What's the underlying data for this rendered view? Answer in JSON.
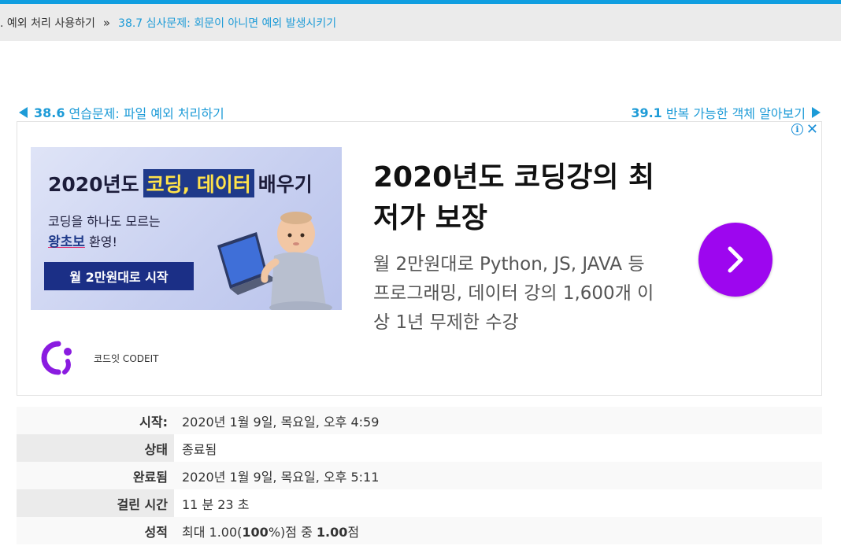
{
  "breadcrumb": {
    "previous": ". 예외 처리 사용하기",
    "separator": "»",
    "current": "38.7 심사문제: 회문이 아니면 예외 발생시키기"
  },
  "navigation": {
    "prev_number": "38.6",
    "prev_label": "연습문제: 파일 예외 처리하기",
    "next_number": "39.1",
    "next_label": "반복 가능한 객체 알아보기"
  },
  "ad": {
    "banner_title_pre": "2020년도",
    "banner_title_highlight": "코딩, 데이터",
    "banner_title_post": "배우기",
    "banner_sub_line1": "코딩을 하나도 모르는",
    "banner_sub_line2_strong": "왕초보",
    "banner_sub_line2_rest": " 환영!",
    "banner_button": "월 2만원대로 시작",
    "advertiser": "코드잇 CODEIT",
    "headline": "2020년도 코딩강의 최저가 보장",
    "description": "월 2만원대로 Python, JS, JAVA 등 프로그래밍, 데이터 강의 1,600개 이상 1년 무제한 수강",
    "info_icon": "info-icon",
    "close_icon": "close-icon",
    "cta_icon": "chevron-right-icon",
    "cta_color": "#9d06ef"
  },
  "summary": [
    {
      "label": "시작:",
      "value": "2020년 1월 9일, 목요일, 오후 4:59"
    },
    {
      "label": "상태",
      "value": "종료됨"
    },
    {
      "label": "완료됨",
      "value": "2020년 1월 9일, 목요일, 오후 5:11"
    },
    {
      "label": "걸린 시간",
      "value": "11 분 23 초"
    },
    {
      "label": "성적",
      "value_pre": "최대 1.00(",
      "value_bold1": "100",
      "value_mid": "%)점 중 ",
      "value_bold2": "1.00",
      "value_post": "점"
    }
  ],
  "colors": {
    "accent": "#0f9ee0",
    "link": "#1d9bd7"
  }
}
